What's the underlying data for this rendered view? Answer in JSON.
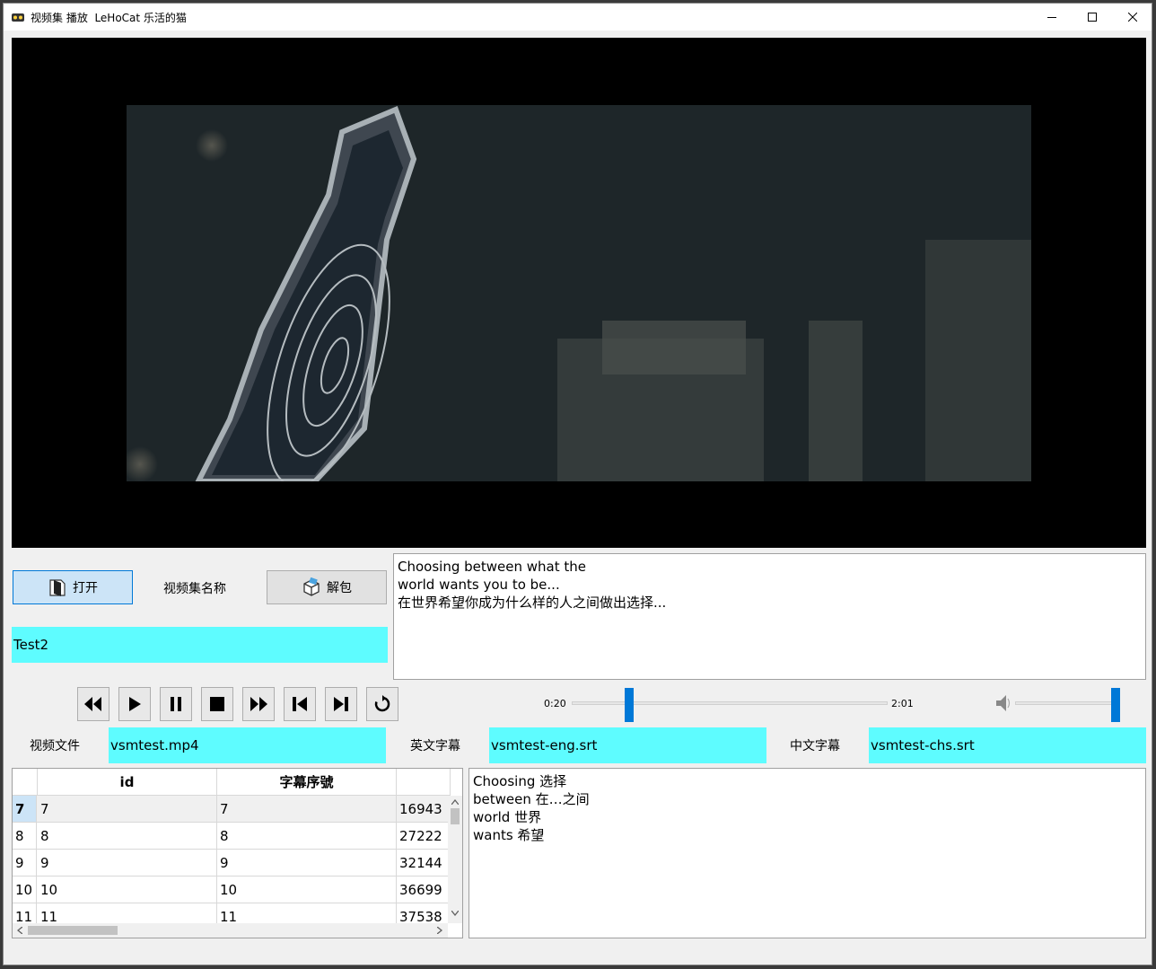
{
  "window": {
    "title": "视频集 播放  LeHoCat 乐活的猫",
    "minimize_symbol": "—",
    "maximize_symbol": "☐",
    "close_symbol": "✕"
  },
  "toolbar": {
    "open_label": "打开",
    "collection_name_label": "视频集名称",
    "unpack_label": "解包",
    "collection_name_value": "Test2"
  },
  "subtitle_display": {
    "lines": [
      "Choosing between what the",
      "world wants you to be...",
      "在世界希望你成为什么样的人之间做出选择..."
    ]
  },
  "playback": {
    "current_time": "0:20",
    "total_time": "2:01",
    "progress_fraction": 0.17,
    "volume_fraction": 1.0,
    "controls": [
      "rewind-icon",
      "play-icon",
      "pause-icon",
      "stop-icon",
      "fast-forward-icon",
      "previous-subtitle-icon",
      "next-subtitle-icon",
      "replay-icon"
    ]
  },
  "files": {
    "video_label": "视频文件",
    "video_value": "vsmtest.mp4",
    "eng_label": "英文字幕",
    "eng_value": "vsmtest-eng.srt",
    "chs_label": "中文字幕",
    "chs_value": "vsmtest-chs.srt"
  },
  "table": {
    "headers": [
      "id",
      "字幕序號"
    ],
    "rows": [
      {
        "row": "7",
        "id": "7",
        "seq": "7",
        "time": "16943"
      },
      {
        "row": "8",
        "id": "8",
        "seq": "8",
        "time": "27222"
      },
      {
        "row": "9",
        "id": "9",
        "seq": "9",
        "time": "32144"
      },
      {
        "row": "10",
        "id": "10",
        "seq": "10",
        "time": "36699"
      },
      {
        "row": "11",
        "id": "11",
        "seq": "11",
        "time": "37538"
      }
    ]
  },
  "vocabulary": {
    "lines": [
      "Choosing 选择",
      "between 在…之间",
      "world 世界",
      "wants 希望"
    ]
  },
  "colors": {
    "field_background": "#5efcff",
    "accent": "#0078d7"
  }
}
